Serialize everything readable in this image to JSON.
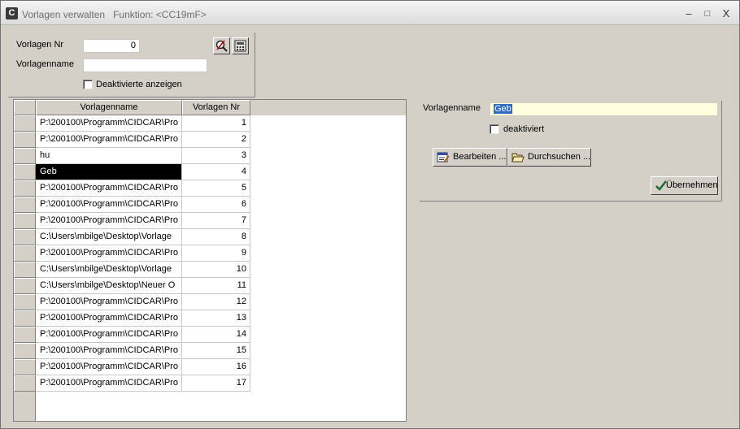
{
  "window": {
    "title": "Vorlagen verwalten",
    "function_label": "Funktion: <CC19mF>",
    "controls": {
      "minimize": "–",
      "maximize": "□",
      "close": "X"
    }
  },
  "filter": {
    "nr_label": "Vorlagen Nr",
    "nr_value": "0",
    "name_label": "Vorlagenname",
    "name_value": "",
    "show_deactivated_label": "Deaktivierte anzeigen"
  },
  "grid": {
    "columns": [
      "Vorlagenname",
      "Vorlagen Nr"
    ],
    "rows": [
      {
        "name": "P:\\200100\\Programm\\CIDCAR\\Pro",
        "nr": "1"
      },
      {
        "name": "P:\\200100\\Programm\\CIDCAR\\Pro",
        "nr": "2"
      },
      {
        "name": "hu",
        "nr": "3"
      },
      {
        "name": "Geb",
        "nr": "4"
      },
      {
        "name": "P:\\200100\\Programm\\CIDCAR\\Pro",
        "nr": "5"
      },
      {
        "name": "P:\\200100\\Programm\\CIDCAR\\Pro",
        "nr": "6"
      },
      {
        "name": "P:\\200100\\Programm\\CIDCAR\\Pro",
        "nr": "7"
      },
      {
        "name": "C:\\Users\\mbilge\\Desktop\\Vorlage",
        "nr": "8"
      },
      {
        "name": "P:\\200100\\Programm\\CIDCAR\\Pro",
        "nr": "9"
      },
      {
        "name": "C:\\Users\\mbilge\\Desktop\\Vorlage",
        "nr": "10"
      },
      {
        "name": "C:\\Users\\mbilge\\Desktop\\Neuer O",
        "nr": "11"
      },
      {
        "name": "P:\\200100\\Programm\\CIDCAR\\Pro",
        "nr": "12"
      },
      {
        "name": "P:\\200100\\Programm\\CIDCAR\\Pro",
        "nr": "13"
      },
      {
        "name": "P:\\200100\\Programm\\CIDCAR\\Pro",
        "nr": "14"
      },
      {
        "name": "P:\\200100\\Programm\\CIDCAR\\Pro",
        "nr": "15"
      },
      {
        "name": "P:\\200100\\Programm\\CIDCAR\\Pro",
        "nr": "16"
      },
      {
        "name": "P:\\200100\\Programm\\CIDCAR\\Pro",
        "nr": "17"
      }
    ],
    "selected_row": 3
  },
  "detail": {
    "name_label": "Vorlagenname",
    "name_value": "Geb",
    "deactivated_label": "deaktiviert",
    "edit_button": "Bearbeiten ...",
    "browse_button": "Durchsuchen ...",
    "apply_button": "Übernehmen"
  },
  "colors": {
    "window_bg": "#d4d0c8",
    "selected_row_bg": "#000000",
    "name_field_bg": "#ffffe0"
  }
}
